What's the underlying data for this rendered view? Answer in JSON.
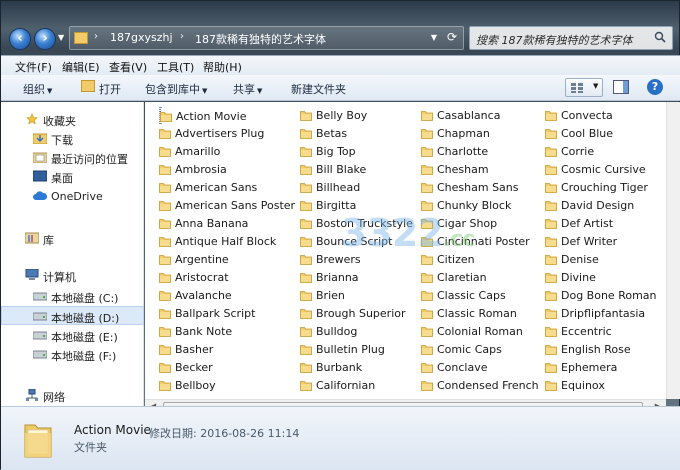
{
  "address": {
    "crumbs": [
      "187gxyszhj",
      "187款稀有独特的艺术字体"
    ],
    "separator": "›",
    "search_placeholder": "搜索 187款稀有独特的艺术字体"
  },
  "menu": [
    "文件(F)",
    "编辑(E)",
    "查看(V)",
    "工具(T)",
    "帮助(H)"
  ],
  "toolbar": {
    "organize": "组织",
    "open": "打开",
    "include": "包含到库中",
    "share": "共享",
    "new_folder": "新建文件夹"
  },
  "nav": {
    "favorites": "收藏夹",
    "downloads": "下载",
    "recent": "最近访问的位置",
    "desktop": "桌面",
    "onedrive": "OneDrive",
    "libraries": "库",
    "computer": "计算机",
    "drive_c": "本地磁盘 (C:)",
    "drive_d": "本地磁盘 (D:)",
    "drive_e": "本地磁盘 (E:)",
    "drive_f": "本地磁盘 (F:)",
    "network": "网络"
  },
  "files": {
    "col1": [
      "Action Movie",
      "Advertisers Plug",
      "Amarillo",
      "Ambrosia",
      "American Sans",
      "American Sans Poster",
      "Anna Banana",
      "Antique Half Block",
      "Argentine",
      "Aristocrat",
      "Avalanche",
      "Ballpark Script",
      "Bank Note",
      "Basher",
      "Becker",
      "Bellboy"
    ],
    "col2": [
      "Belly Boy",
      "Betas",
      "Big Top",
      "Bill Blake",
      "Billhead",
      "Birgitta",
      "Boston Truckstyle",
      "Bounce Script",
      "Brewers",
      "Brianna",
      "Brien",
      "Brough Superior",
      "Bulldog",
      "Bulletin Plug",
      "Burbank",
      "Californian"
    ],
    "col3": [
      "Casablanca",
      "Chapman",
      "Charlotte",
      "Chesham",
      "Chesham Sans",
      "Chunky Block",
      "Cigar Shop",
      "Cincinnati Poster",
      "Citizen",
      "Claretian",
      "Classic Caps",
      "Classic Roman",
      "Colonial Roman",
      "Comic Caps",
      "Conclave",
      "Condensed French"
    ],
    "col4": [
      "Convecta",
      "Cool Blue",
      "Corrie",
      "Cosmic Cursive",
      "Crouching Tiger",
      "David Design",
      "Def Artist",
      "Def Writer",
      "Denise",
      "Divine",
      "Dog Bone Roman",
      "Dripflipfantasia",
      "Eccentric",
      "English Rose",
      "Ephemera",
      "Equinox"
    ]
  },
  "watermark": {
    "main": "3322",
    "suffix": ".cc"
  },
  "details": {
    "name": "Action Movie",
    "meta": "修改日期: 2016-08-26 11:14",
    "type": "文件夹"
  }
}
